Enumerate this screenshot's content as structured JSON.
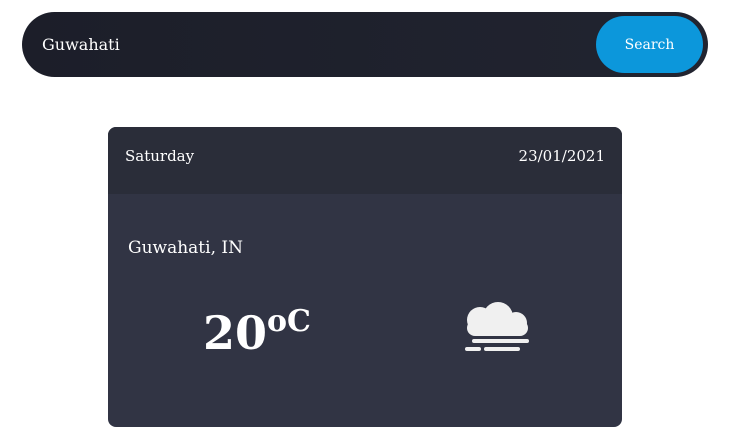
{
  "search": {
    "value": "Guwahati",
    "button_label": "Search"
  },
  "card": {
    "day": "Saturday",
    "date": "23/01/2021",
    "location": "Guwahati, IN",
    "temperature_value": "20",
    "temperature_unit": "oC",
    "weather_icon": "mist-fog-icon"
  },
  "colors": {
    "search_bar_bg": "#1c1e29",
    "search_button_bg": "#0c97db",
    "card_bg": "#313444",
    "card_header_bg": "#2a2d39"
  }
}
